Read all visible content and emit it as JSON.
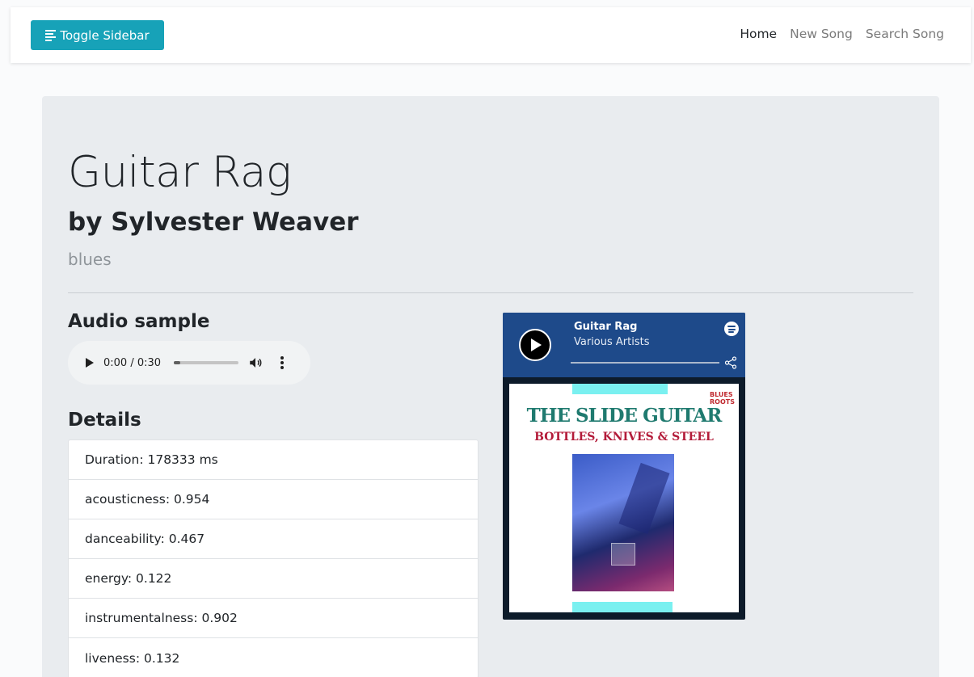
{
  "navbar": {
    "toggle_label": "Toggle Sidebar",
    "links": [
      "Home",
      "New Song",
      "Search Song"
    ],
    "accent": "#17a2b8"
  },
  "song": {
    "title": "Guitar Rag",
    "by": "by Sylvester Weaver",
    "genre": "blues"
  },
  "audio": {
    "heading": "Audio sample",
    "time": "0:00 / 0:30",
    "progress": 0.0
  },
  "details": {
    "heading": "Details",
    "items": [
      "Duration: 178333 ms",
      "acousticness: 0.954",
      "danceability: 0.467",
      "energy: 0.122",
      "instrumentalness: 0.902",
      "liveness: 0.132"
    ]
  },
  "spotify_embed": {
    "track": "Guitar Rag",
    "artist": "Various Artists",
    "cover_text_line1": "THE SLIDE GUITAR",
    "cover_text_line2": "BOTTLES, KNIVES & STEEL",
    "cover_badge": "BLUES ROOTS"
  }
}
